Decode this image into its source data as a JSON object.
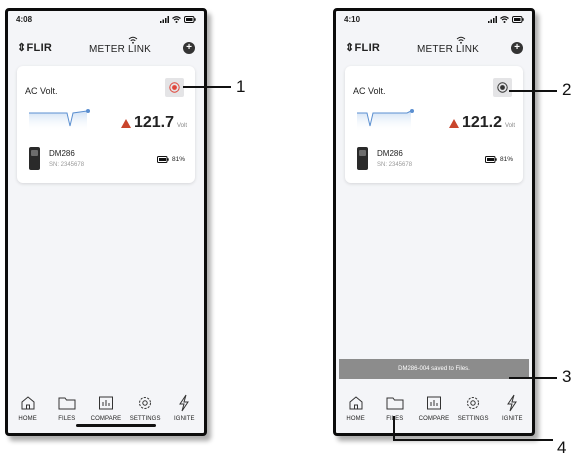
{
  "phones": [
    {
      "time": "4:08",
      "brand": "FLIR",
      "app_name": "METER LINK",
      "card": {
        "title": "AC Volt.",
        "value": "121.7",
        "unit": "Volt",
        "device_name": "DM286",
        "serial": "SN: 2345678",
        "battery": "81%",
        "recording": true
      },
      "tabs": [
        "HOME",
        "FILES",
        "COMPARE",
        "SETTINGS",
        "IGNITE"
      ]
    },
    {
      "time": "4:10",
      "brand": "FLIR",
      "app_name": "METER LINK",
      "card": {
        "title": "AC Volt.",
        "value": "121.2",
        "unit": "Volt",
        "device_name": "DM286",
        "serial": "SN: 2345678",
        "battery": "81%",
        "recording": false
      },
      "toast": "DM286-004 saved to Files.",
      "tabs": [
        "HOME",
        "FILES",
        "COMPARE",
        "SETTINGS",
        "IGNITE"
      ]
    }
  ],
  "callouts": [
    "1",
    "2",
    "3",
    "4"
  ],
  "colors": {
    "record_active": "#e0453a",
    "record_idle": "#333333",
    "trend_up": "#c9452c",
    "sparkline": "#5b8fd0"
  },
  "icons": [
    "home-icon",
    "folder-icon",
    "compare-icon",
    "gear-icon",
    "flash-icon",
    "plus-icon",
    "record-icon",
    "battery-icon"
  ]
}
